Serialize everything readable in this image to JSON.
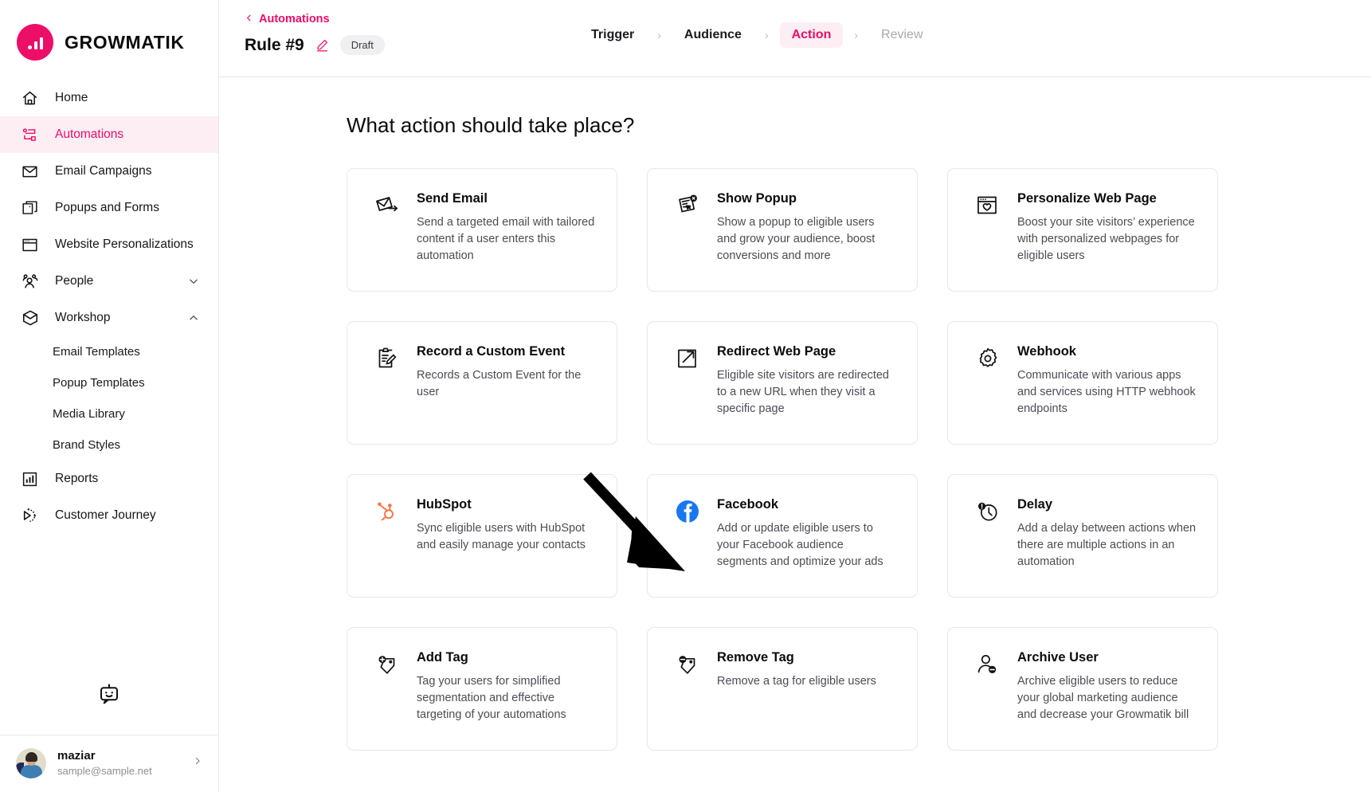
{
  "brand": {
    "name": "GROWMATIK",
    "logo_icon": "growmatik-bars-logo"
  },
  "accent_color": "#ec0e67",
  "sidebar": {
    "items": [
      {
        "label": "Home",
        "icon": "home-icon",
        "active": false
      },
      {
        "label": "Automations",
        "icon": "automations-flow-icon",
        "active": true
      },
      {
        "label": "Email Campaigns",
        "icon": "envelope-icon",
        "active": false
      },
      {
        "label": "Popups and Forms",
        "icon": "popup-windows-icon",
        "active": false
      },
      {
        "label": "Website Personalizations",
        "icon": "browser-window-icon",
        "active": false
      },
      {
        "label": "People",
        "icon": "people-group-icon",
        "active": false,
        "expandable": true,
        "expanded": false
      },
      {
        "label": "Workshop",
        "icon": "box-icon",
        "active": false,
        "expandable": true,
        "expanded": true
      }
    ],
    "workshop_children": [
      {
        "label": "Email Templates"
      },
      {
        "label": "Popup Templates"
      },
      {
        "label": "Media Library"
      },
      {
        "label": "Brand Styles"
      }
    ],
    "items_after": [
      {
        "label": "Reports",
        "icon": "bar-chart-icon"
      },
      {
        "label": "Customer Journey",
        "icon": "journey-path-icon"
      }
    ],
    "bot_icon": "chat-bot-icon",
    "profile": {
      "name": "maziar",
      "email": "sample@sample.net",
      "avatar_icon": "user-avatar-photo",
      "chevron_icon": "chevron-right-icon"
    }
  },
  "topbar": {
    "back_label": "Automations",
    "back_icon": "chevron-left-icon",
    "rule_title": "Rule #9",
    "edit_icon": "pencil-edit-icon",
    "status_badge": "Draft",
    "steps": [
      {
        "label": "Trigger",
        "state": "done"
      },
      {
        "label": "Audience",
        "state": "done"
      },
      {
        "label": "Action",
        "state": "current"
      },
      {
        "label": "Review",
        "state": "upcoming"
      }
    ],
    "step_separator": "›"
  },
  "main": {
    "title": "What action should take place?",
    "cards": [
      {
        "title": "Send Email",
        "desc": "Send a targeted email with tailored content if a user enters this automation",
        "icon": "send-email-icon"
      },
      {
        "title": "Show Popup",
        "desc": "Show a popup to eligible users and grow your audience, boost conversions and more",
        "icon": "show-popup-icon"
      },
      {
        "title": "Personalize Web Page",
        "desc": "Boost your site visitors’ experience with personalized webpages for eligible users",
        "icon": "personalize-webpage-icon"
      },
      {
        "title": "Record a Custom Event",
        "desc": "Records a Custom Event for the user",
        "icon": "record-custom-event-icon"
      },
      {
        "title": "Redirect Web Page",
        "desc": "Eligible site visitors are redirected to a new URL when they visit a specific page",
        "icon": "redirect-webpage-icon"
      },
      {
        "title": "Webhook",
        "desc": "Communicate with various apps and services using HTTP webhook endpoints",
        "icon": "webhook-gear-icon"
      },
      {
        "title": "HubSpot",
        "desc": "Sync eligible users with HubSpot and easily manage your contacts",
        "icon": "hubspot-icon"
      },
      {
        "title": "Facebook",
        "desc": "Add or update eligible users to your Facebook audience segments and optimize your ads",
        "icon": "facebook-icon"
      },
      {
        "title": "Delay",
        "desc": "Add a delay between actions when there are multiple actions in an automation",
        "icon": "delay-clock-icon"
      },
      {
        "title": "Add Tag",
        "desc": "Tag your users for simplified segmentation and effective targeting of your automations",
        "icon": "add-tag-icon"
      },
      {
        "title": "Remove Tag",
        "desc": "Remove a tag for eligible users",
        "icon": "remove-tag-icon"
      },
      {
        "title": "Archive User",
        "desc": "Archive eligible users to reduce your global marketing audience and decrease your Growmatik bill",
        "icon": "archive-user-icon"
      }
    ]
  },
  "annotation": {
    "type": "pointer-arrow",
    "points_to": "HubSpot",
    "color": "#000000"
  }
}
